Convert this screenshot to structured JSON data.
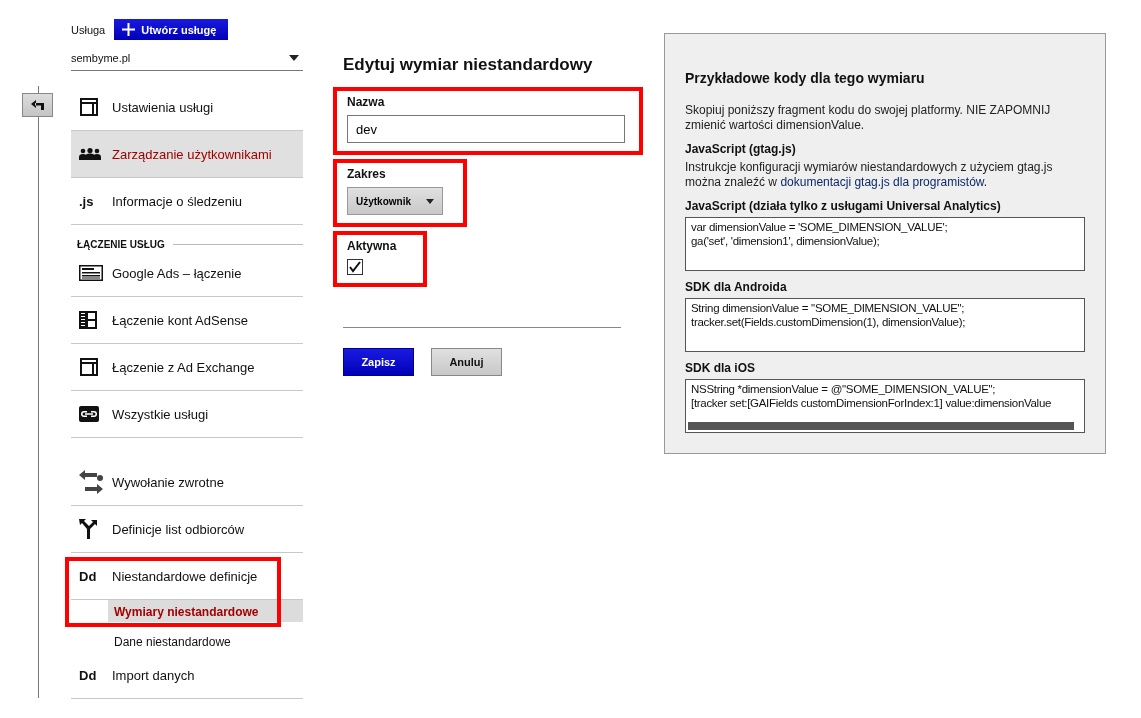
{
  "property": {
    "label": "Usługa",
    "create_button": "Utwórz usługę",
    "selected": "sembyme.pl"
  },
  "sidebar": {
    "groups": [
      {
        "items": [
          {
            "kind": "panel",
            "label": "Ustawienia usługi",
            "selected": false
          },
          {
            "kind": "people",
            "label": "Zarządzanie użytkownikami",
            "selected": true
          },
          {
            "kind": "text-icon",
            "icon_text": ".js",
            "label": "Informacje o śledzeniu",
            "selected": false
          }
        ]
      },
      {
        "heading": "ŁĄCZENIE USŁUG",
        "items": [
          {
            "kind": "list",
            "label": "Google Ads – łączenie",
            "selected": false
          },
          {
            "kind": "columns",
            "label": "Łączenie kont AdSense",
            "selected": false
          },
          {
            "kind": "panel",
            "label": "Łączenie z Ad Exchange",
            "selected": false
          },
          {
            "kind": "link",
            "label": "Wszystkie usługi",
            "selected": false
          }
        ]
      },
      {
        "items": [
          {
            "kind": "swap",
            "label": "Wywołanie zwrotne",
            "selected": false
          },
          {
            "kind": "fork",
            "label": "Definicje list odbiorców",
            "selected": false
          },
          {
            "kind": "text-icon",
            "icon_text": "Dd",
            "label": "Niestandardowe definicje",
            "selected": false,
            "highlighted": true,
            "children": [
              {
                "label": "Wymiary niestandardowe",
                "selected": true
              },
              {
                "label": "Dane niestandardowe",
                "selected": false
              }
            ]
          },
          {
            "kind": "text-icon",
            "icon_text": "Dd",
            "label": "Import danych",
            "selected": false
          }
        ]
      }
    ]
  },
  "form": {
    "title": "Edytuj wymiar niestandardowy",
    "fields": [
      {
        "kind": "text",
        "label": "Nazwa",
        "value": "dev",
        "highlighted": true
      },
      {
        "kind": "select",
        "label": "Zakres",
        "value": "Użytkownik",
        "highlighted": true
      },
      {
        "kind": "checkbox",
        "label": "Aktywna",
        "checked": true,
        "highlighted": true
      }
    ],
    "buttons": [
      {
        "kind": "primary",
        "label": "Zapisz"
      },
      {
        "kind": "secondary",
        "label": "Anuluj"
      }
    ]
  },
  "code_panel": {
    "title": "Przykładowe kody dla tego wymiaru",
    "intro": "Skopiuj poniższy fragment kodu do swojej platformy. NIE ZAPOMNIJ zmienić wartości dimensionValue.",
    "sections": [
      {
        "heading": "JavaScript (gtag.js)",
        "text": "Instrukcje konfiguracji wymiarów niestandardowych z użyciem gtag.js można znaleźć w ",
        "link": "dokumentacji gtag.js dla programistów",
        "text_after": "."
      },
      {
        "heading": "JavaScript (działa tylko z usługami Universal Analytics)",
        "code": [
          "var dimensionValue = 'SOME_DIMENSION_VALUE';",
          "ga('set', 'dimension1', dimensionValue);"
        ],
        "scrollbar": false
      },
      {
        "heading": "SDK dla Androida",
        "code": [
          "String dimensionValue = \"SOME_DIMENSION_VALUE\";",
          "tracker.set(Fields.customDimension(1), dimensionValue);"
        ],
        "scrollbar": false
      },
      {
        "heading": "SDK dla iOS",
        "code": [
          "NSString *dimensionValue = @\"SOME_DIMENSION_VALUE\";",
          "[tracker set:[GAIFields customDimensionForIndex:1] value:dimensionValue"
        ],
        "scrollbar": true
      }
    ]
  }
}
